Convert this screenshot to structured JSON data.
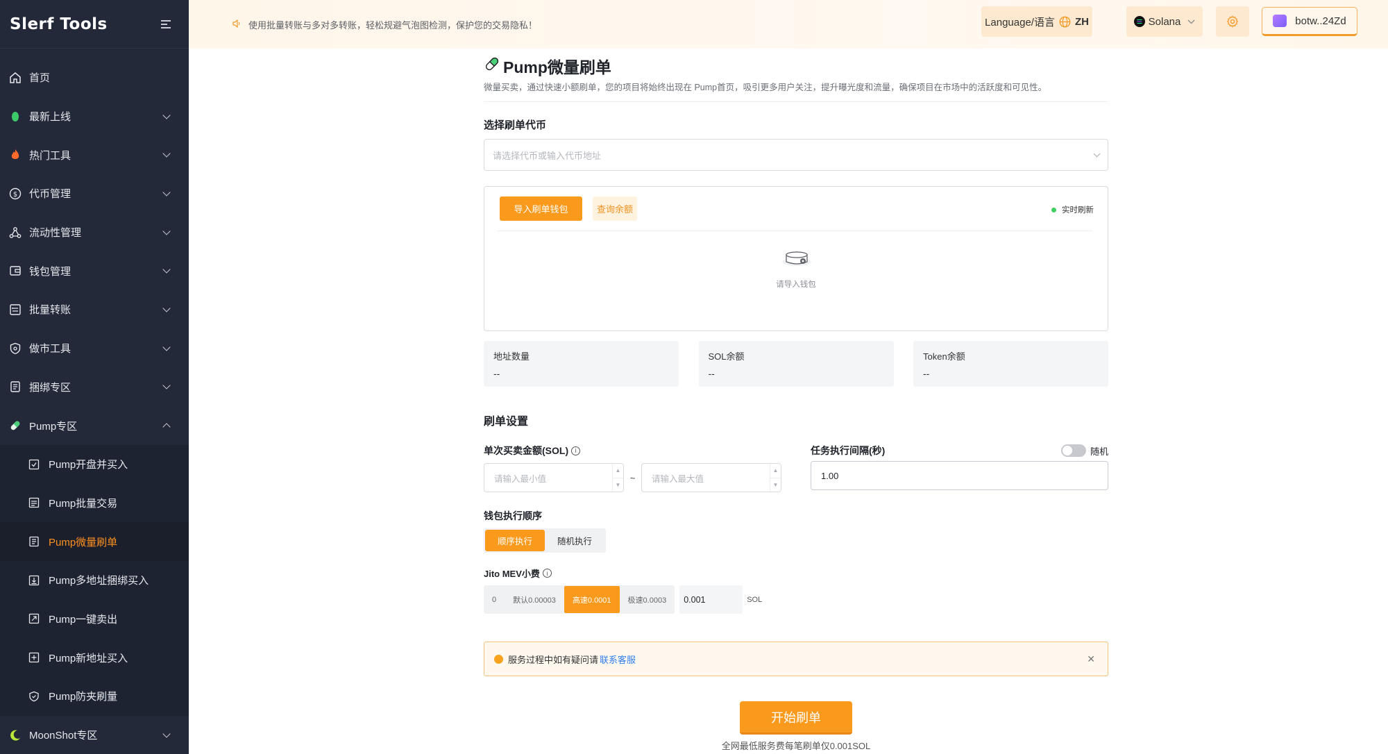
{
  "brand": {
    "logo_text": "Slerf Tools"
  },
  "header": {
    "notice": "使用批量转账与多对多转账，轻松规避气泡图检测，保护您的交易隐私！",
    "language_label": "Language/语言",
    "language_code": "ZH",
    "chain": "Solana",
    "wallet": "botw..24Zd"
  },
  "sidebar": {
    "items": [
      {
        "label": "首页",
        "icon": "home-icon"
      },
      {
        "label": "最新上线",
        "icon": "sprout-icon"
      },
      {
        "label": "热门工具",
        "icon": "fire-icon"
      },
      {
        "label": "代币管理",
        "icon": "dollar-icon"
      },
      {
        "label": "流动性管理",
        "icon": "network-icon"
      },
      {
        "label": "钱包管理",
        "icon": "wallet-icon"
      },
      {
        "label": "批量转账",
        "icon": "batch-icon"
      },
      {
        "label": "做市工具",
        "icon": "shield-icon"
      },
      {
        "label": "捆绑专区",
        "icon": "bundle-icon"
      },
      {
        "label": "Pump专区",
        "icon": "pill-icon"
      },
      {
        "label": "MoonShot专区",
        "icon": "moon-icon"
      }
    ],
    "pump_sub": [
      {
        "label": "Pump开盘并买入"
      },
      {
        "label": "Pump批量交易"
      },
      {
        "label": "Pump微量刷单"
      },
      {
        "label": "Pump多地址捆绑买入"
      },
      {
        "label": "Pump一键卖出"
      },
      {
        "label": "Pump新地址买入"
      },
      {
        "label": "Pump防夹刷量"
      }
    ]
  },
  "page": {
    "title": "Pump微量刷单",
    "description": "微量买卖，通过快速小额刷单，您的项目将始终出现在 Pump首页，吸引更多用户关注，提升曝光度和流量，确保项目在市场中的活跃度和可见性。",
    "select_token_label": "选择刷单代币",
    "select_token_placeholder": "请选择代币或输入代币地址",
    "import_wallet": "导入刷单钱包",
    "check_balance": "查询余额",
    "live_refresh": "实时刷新",
    "empty_text": "请导入钱包",
    "stats": [
      {
        "label": "地址数量",
        "value": "--"
      },
      {
        "label": "SOL余额",
        "value": "--"
      },
      {
        "label": "Token余额",
        "value": "--"
      }
    ],
    "settings_title": "刷单设置",
    "amount_label": "单次买卖金额(SOL)",
    "min_placeholder": "请输入最小值",
    "max_placeholder": "请输入最大值",
    "tilde": "~",
    "interval_label": "任务执行间隔(秒)",
    "random_label": "随机",
    "interval_value": "1.00",
    "order_label": "钱包执行顺序",
    "order_options": [
      "顺序执行",
      "随机执行"
    ],
    "jito_label": "Jito MEV小费",
    "jito_options": [
      "0",
      "默认0.00003",
      "高速0.0001",
      "极速0.0003"
    ],
    "jito_value": "0.001",
    "jito_unit": "SOL",
    "alert_text": "服务过程中如有疑问请",
    "alert_link": "联系客服",
    "start_button": "开始刷单",
    "fee_note": "全网最低服务费每笔刷单仅0.001SOL"
  },
  "colors": {
    "accent": "#f99a1c",
    "sidebar_bg": "#232938",
    "active_text": "#ff8f1f"
  }
}
